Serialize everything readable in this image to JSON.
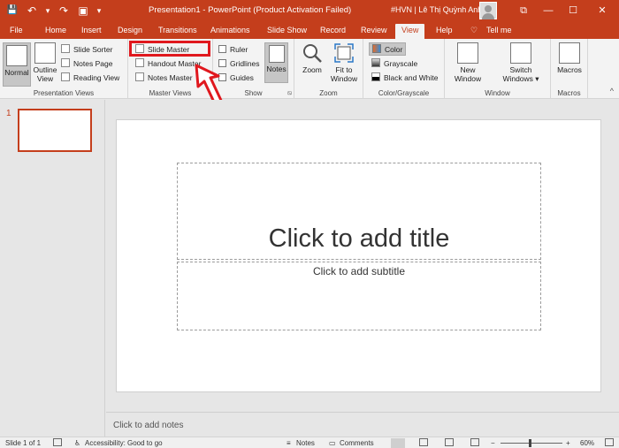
{
  "titlebar": {
    "doc_title": "Presentation1  -  PowerPoint (Product Activation Failed)",
    "user": "#HVN | Lê Thị Quỳnh Anh",
    "accent": "#c43e1c"
  },
  "qat": {
    "save": "💾",
    "undo": "↶",
    "undo_dropdown": "▾",
    "redo": "↷",
    "slideshow": "▣",
    "customize": "▾"
  },
  "window_controls": {
    "ribbon_display": "⧉",
    "minimize": "—",
    "maximize": "☐",
    "close": "✕"
  },
  "tabs": [
    "File",
    "Home",
    "Insert",
    "Design",
    "Transitions",
    "Animations",
    "Slide Show",
    "Record",
    "Review",
    "View",
    "Help",
    "Tell me"
  ],
  "tell_me_icon": "♡",
  "active_tab": "View",
  "ribbon": {
    "presentation_views": {
      "label": "Presentation Views",
      "normal": "Normal",
      "outline_1": "Outline",
      "outline_2": "View",
      "slide_sorter": "Slide Sorter",
      "notes_page": "Notes Page",
      "reading_view": "Reading View"
    },
    "master_views": {
      "label": "Master Views",
      "slide_master": "Slide Master",
      "handout_master": "Handout Master",
      "notes_master": "Notes Master"
    },
    "show": {
      "label": "Show",
      "ruler": "Ruler",
      "gridlines": "Gridlines",
      "guides": "Guides",
      "notes": "Notes",
      "launcher": "⧅"
    },
    "zoom": {
      "label": "Zoom",
      "zoom": "Zoom",
      "fit_1": "Fit to",
      "fit_2": "Window"
    },
    "color": {
      "label": "Color/Grayscale",
      "color": "Color",
      "grayscale": "Grayscale",
      "bw": "Black and White"
    },
    "window": {
      "label": "Window",
      "new_1": "New",
      "new_2": "Window",
      "switch_1": "Switch",
      "switch_2": "Windows ▾"
    },
    "macros": {
      "label": "Macros",
      "macros": "Macros"
    }
  },
  "thumbnails": {
    "number": "1"
  },
  "slide": {
    "title_placeholder": "Click to add title",
    "subtitle_placeholder": "Click to add subtitle"
  },
  "notes_placeholder": "Click to add notes",
  "statusbar": {
    "slide_info": "Slide 1 of 1",
    "accessibility": "Accessibility: Good to go",
    "notes": "Notes",
    "comments": "Comments",
    "zoom_minus": "−",
    "zoom_plus": "+",
    "zoom_level": "60%"
  }
}
